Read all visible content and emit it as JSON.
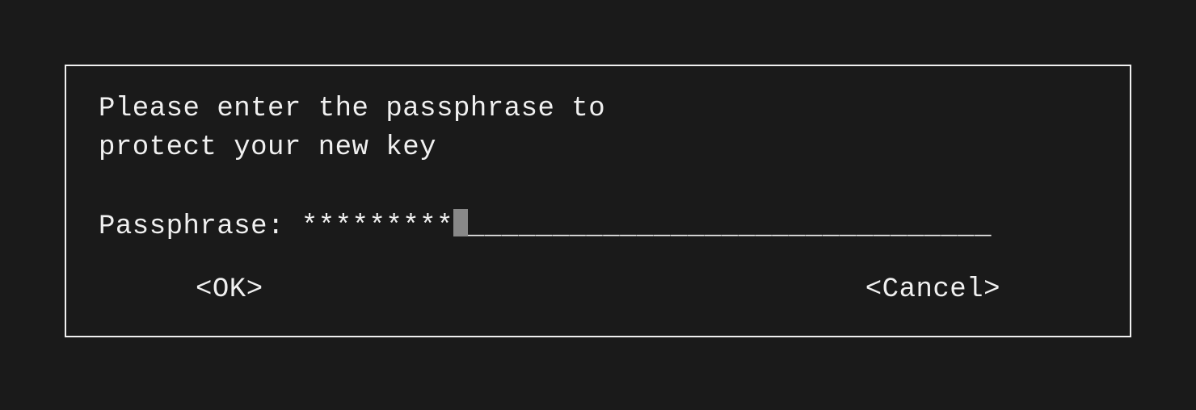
{
  "dialog": {
    "prompt_line1": "Please enter the passphrase to",
    "prompt_line2": "protect your new key",
    "input_label": "Passphrase: ",
    "input_value_masked": "*********",
    "input_underline": "_______________________________",
    "ok_label": "<OK>",
    "cancel_label": "<Cancel>"
  }
}
